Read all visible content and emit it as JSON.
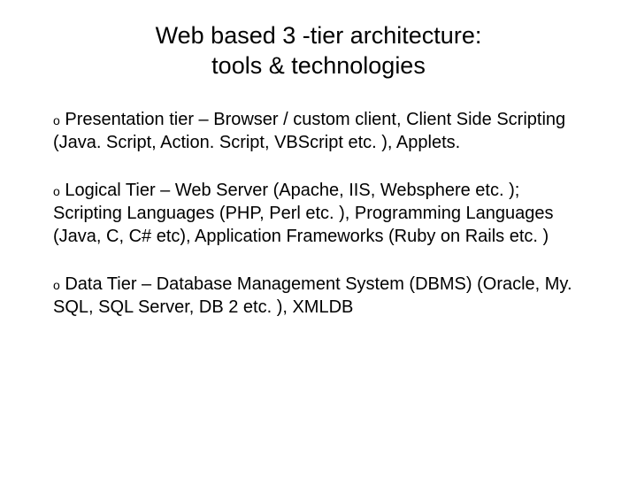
{
  "title_line1": "Web based 3 -tier architecture:",
  "title_line2": "tools & technologies",
  "bullets": [
    {
      "marker": "o",
      "text": " Presentation tier – Browser / custom client, Client Side Scripting (Java. Script, Action. Script, VBScript etc. ), Applets."
    },
    {
      "marker": "o",
      "text": " Logical Tier – Web Server (Apache, IIS, Websphere etc. ); Scripting Languages (PHP, Perl etc. ), Programming Languages (Java, C, C# etc), Application Frameworks (Ruby on Rails etc. )"
    },
    {
      "marker": "o",
      "text": " Data Tier  –  Database Management System (DBMS) (Oracle, My. SQL, SQL Server, DB 2 etc. ), XMLDB"
    }
  ]
}
